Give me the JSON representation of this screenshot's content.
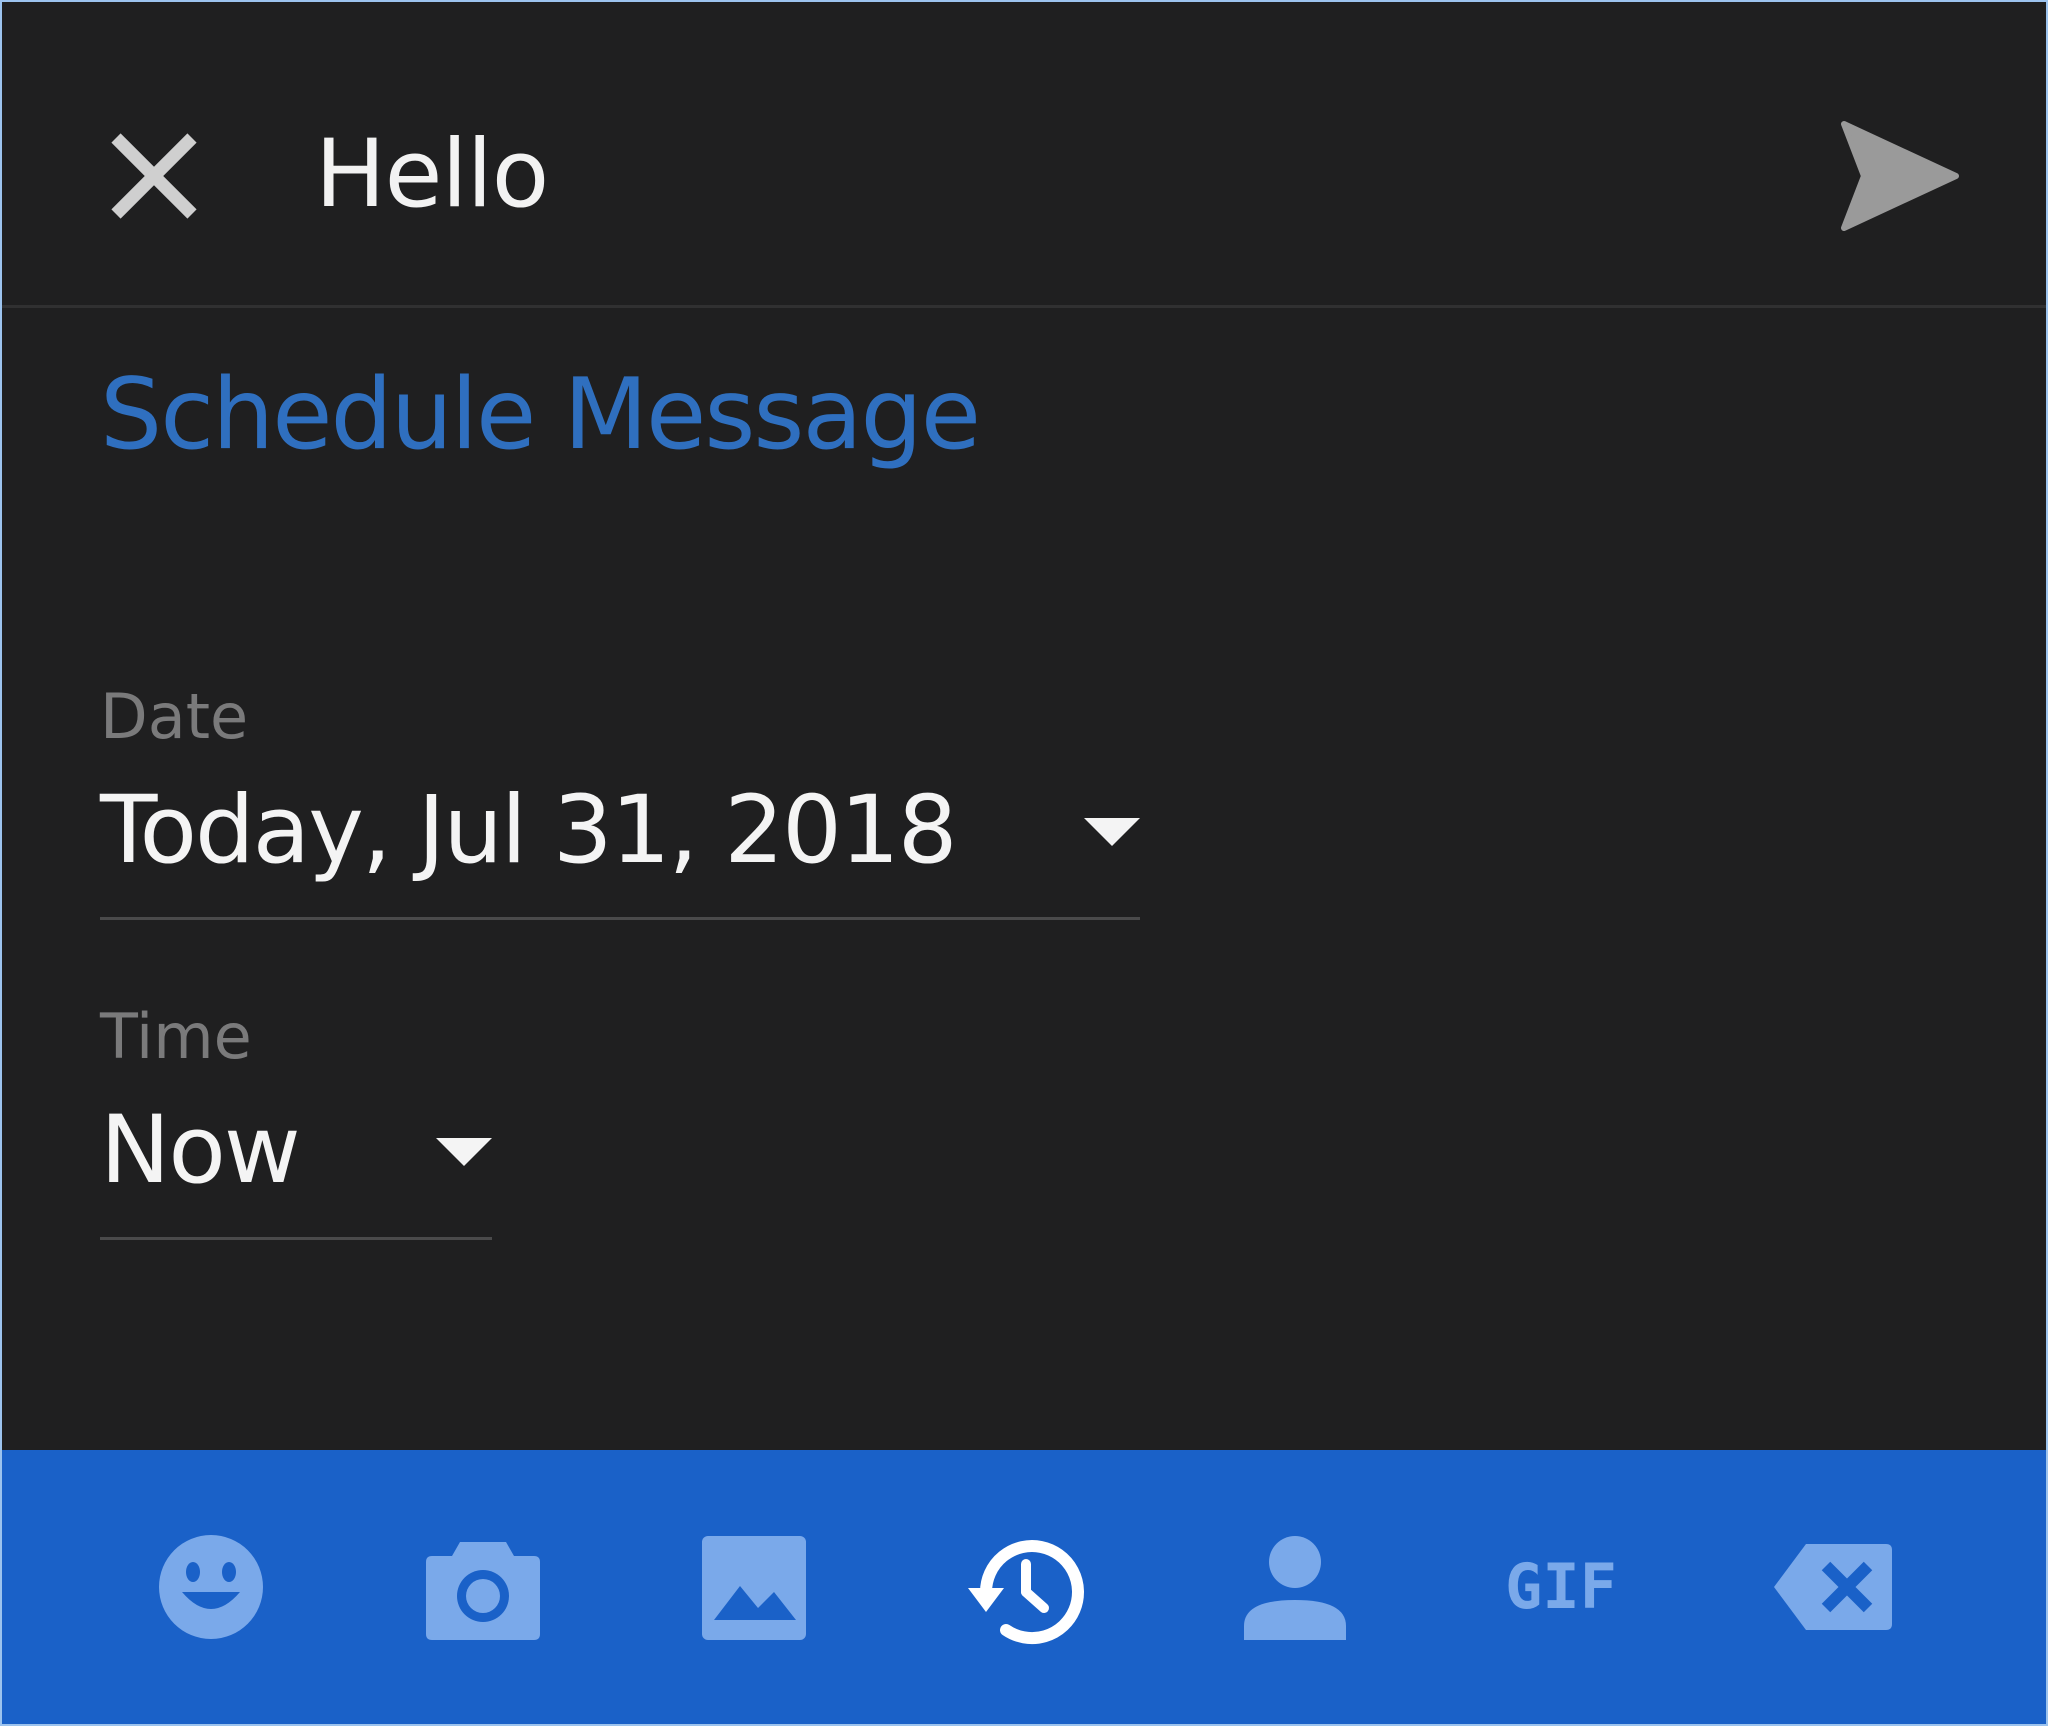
{
  "header": {
    "title": "Hello",
    "close_icon": "close-icon",
    "send_icon": "send-icon"
  },
  "schedule": {
    "title": "Schedule Message",
    "date": {
      "label": "Date",
      "value": "Today, Jul 31, 2018"
    },
    "time": {
      "label": "Time",
      "value": "Now"
    }
  },
  "toolbar": {
    "items": [
      {
        "icon": "emoji-icon"
      },
      {
        "icon": "camera-icon"
      },
      {
        "icon": "gallery-icon"
      },
      {
        "icon": "schedule-history-icon",
        "active": true
      },
      {
        "icon": "contact-icon"
      },
      {
        "icon": "gif-icon",
        "label": "GIF"
      },
      {
        "icon": "backspace-icon"
      }
    ]
  },
  "colors": {
    "background": "#1f1f20",
    "accent": "#2f6fbf",
    "toolbar": "#1a61c8",
    "toolbar_icon": "#7aa9ea",
    "toolbar_icon_active": "#ffffff",
    "text": "#f4f4f4",
    "label": "#7a7a7b"
  }
}
